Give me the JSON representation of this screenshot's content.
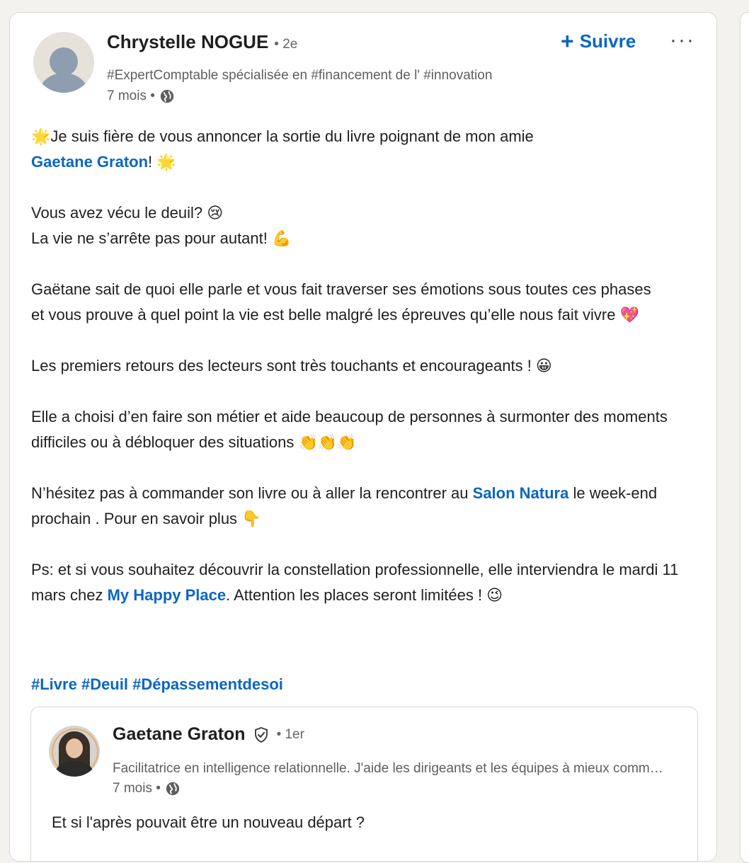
{
  "author": {
    "name": "Chrystelle NOGUE",
    "degree": "• 2e",
    "headline": "#ExpertComptable spécialisée en #financement de l' #innovation",
    "time": "7 mois •",
    "visibility_icon": "globe-icon"
  },
  "actions": {
    "follow_plus": "+",
    "follow_label": "Suivre",
    "more_label": "···"
  },
  "post": {
    "p1_a": "🌟Je suis fière de vous annoncer la sortie du livre poignant de mon amie ",
    "p1_link": "Gaetane Graton",
    "p1_b": "! 🌟",
    "p2_line1": "Vous avez vécu le deuil? 😢",
    "p2_line2": "La vie ne s’arrête pas pour autant! 💪",
    "p3": "Gaëtane sait de quoi elle parle et vous fait traverser ses émotions sous toutes ces phases et vous prouve à quel point la vie est belle malgré les épreuves qu’elle nous fait vivre 💖",
    "p4": "Les premiers retours des lecteurs sont très touchants et encourageants ! 😀",
    "p5": "Elle a choisi d’en faire son métier et aide beaucoup de personnes à surmonter des moments difficiles ou à débloquer des situations 👏👏👏",
    "p6_a": "N’hésitez pas à commander son livre ou à aller la rencontrer au ",
    "p6_link": "Salon Natura",
    "p6_b": " le week-end prochain . Pour en savoir plus 👇",
    "p7_a": "Ps: et si vous souhaitez découvrir la constellation professionnelle, elle interviendra le mardi 11 mars chez ",
    "p7_link": "My Happy Place",
    "p7_b": ". Attention les places seront limitées ! 😉",
    "hashtags": [
      "#Livre",
      "#Deuil",
      "#Dépassementdesoi"
    ]
  },
  "shared_post": {
    "name": "Gaetane Graton",
    "verified_icon": "shield-check-icon",
    "degree": "• 1er",
    "headline": "Facilitatrice en intelligence relationnelle. J'aide les dirigeants et les équipes à mieux communiquer",
    "time": "7 mois •",
    "text": "Et si l'après pouvait être un nouveau départ ?"
  },
  "colors": {
    "link": "#0a66c2",
    "background": "#f4f2ee",
    "card": "#ffffff"
  }
}
